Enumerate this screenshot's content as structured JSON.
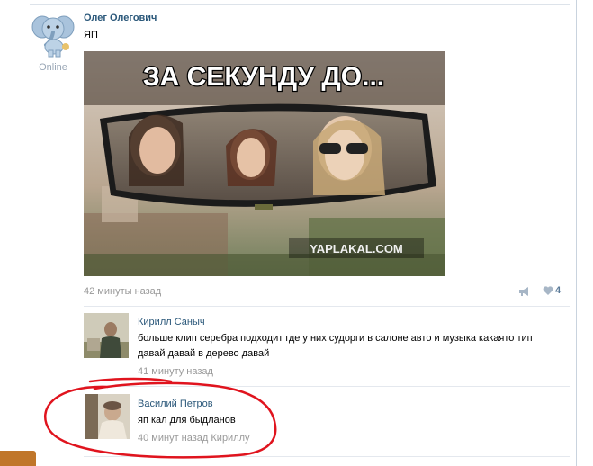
{
  "post": {
    "author": "Олег Олегович",
    "status": "Online",
    "text": "ЯП",
    "image_caption": "ЗА СЕКУНДУ ДО...",
    "watermark": "YAPLAKAL.COM",
    "time": "42 минуты назад",
    "likes": "4"
  },
  "comments": [
    {
      "author": "Кирилл Саныч",
      "text": "больше клип серебра подходит где у них судорги в салоне авто и музыка какаято тип давай давай в дерево давай",
      "time": "41 минуту назад"
    },
    {
      "author": "Василий Петров",
      "text": "яп кал для быдланов",
      "time": "40 минут назад",
      "reply_to": "Кириллу"
    }
  ],
  "colors": {
    "link": "#2b587a",
    "muted": "#999999",
    "annotation": "#e0141e"
  }
}
